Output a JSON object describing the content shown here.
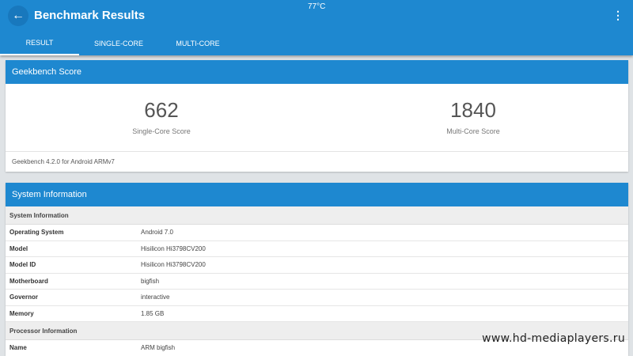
{
  "status": {
    "temperature": "77°C"
  },
  "appbar": {
    "title": "Benchmark Results",
    "back_icon": "arrow-back-icon",
    "overflow_icon": "more-vert-icon"
  },
  "tabs": [
    {
      "label": "RESULT",
      "active": true
    },
    {
      "label": "SINGLE-CORE",
      "active": false
    },
    {
      "label": "MULTI-CORE",
      "active": false
    }
  ],
  "score_card": {
    "header": "Geekbench Score",
    "single": {
      "value": "662",
      "label": "Single-Core Score"
    },
    "multi": {
      "value": "1840",
      "label": "Multi-Core Score"
    },
    "footnote": "Geekbench 4.2.0 for Android ARMv7"
  },
  "system_card": {
    "header": "System Information",
    "section1": "System Information",
    "rows": [
      {
        "key": "Operating System",
        "value": "Android 7.0"
      },
      {
        "key": "Model",
        "value": "Hisilicon Hi3798CV200"
      },
      {
        "key": "Model ID",
        "value": "Hisilicon Hi3798CV200"
      },
      {
        "key": "Motherboard",
        "value": "bigfish"
      },
      {
        "key": "Governor",
        "value": "interactive"
      },
      {
        "key": "Memory",
        "value": "1.85 GB"
      }
    ],
    "section2": "Processor Information",
    "rows2": [
      {
        "key": "Name",
        "value": "ARM bigfish"
      }
    ]
  },
  "watermark": "www.hd-mediaplayers.ru",
  "colors": {
    "primary": "#1e88d0",
    "background": "#dfe3e6"
  }
}
